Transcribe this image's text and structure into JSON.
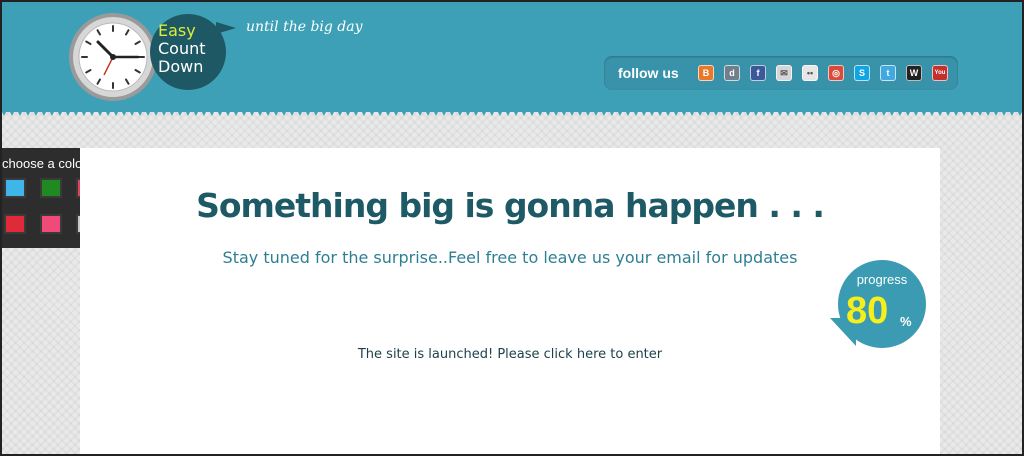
{
  "header": {
    "logo_lines": [
      "Easy",
      "Count",
      "Down"
    ],
    "tagline": "until the big day",
    "follow_label": "follow us",
    "social_icons": [
      {
        "name": "blogger-icon",
        "glyph": "B",
        "color": "#e8782a"
      },
      {
        "name": "delicious-icon",
        "glyph": "d",
        "color": "#6f7f8c"
      },
      {
        "name": "facebook-icon",
        "glyph": "f",
        "color": "#3b5998"
      },
      {
        "name": "email-icon",
        "glyph": "✉",
        "color": "#d6d6d6"
      },
      {
        "name": "flickr-icon",
        "glyph": "••",
        "color": "#e6e6e6"
      },
      {
        "name": "picasa-icon",
        "glyph": "◎",
        "color": "#d94a3a"
      },
      {
        "name": "skype-icon",
        "glyph": "S",
        "color": "#12a5e4"
      },
      {
        "name": "twitter-icon",
        "glyph": "t",
        "color": "#3fa9e0"
      },
      {
        "name": "wordpress-icon",
        "glyph": "W",
        "color": "#222222"
      },
      {
        "name": "youtube-icon",
        "glyph": "You",
        "color": "#c4302b"
      }
    ]
  },
  "color_picker": {
    "title": "choose a color",
    "swatches": [
      "#3eb6ea",
      "#1f8a22",
      "#e0415c",
      "#e02a3a",
      "#ef4a7a",
      "#c9c9c9"
    ]
  },
  "main": {
    "headline": "Something big is gonna happen . . .",
    "subline": "Stay tuned for the surprise..Feel free to leave us your email for updates",
    "launch_link": "The site is launched! Please click here to enter"
  },
  "progress": {
    "label": "progress",
    "value": "80",
    "unit": "%"
  },
  "colors": {
    "header_bg": "#3ea0b7",
    "logo_bubble": "#1e5864",
    "headline": "#1e5a66",
    "progress_value": "#f7ef1c"
  }
}
